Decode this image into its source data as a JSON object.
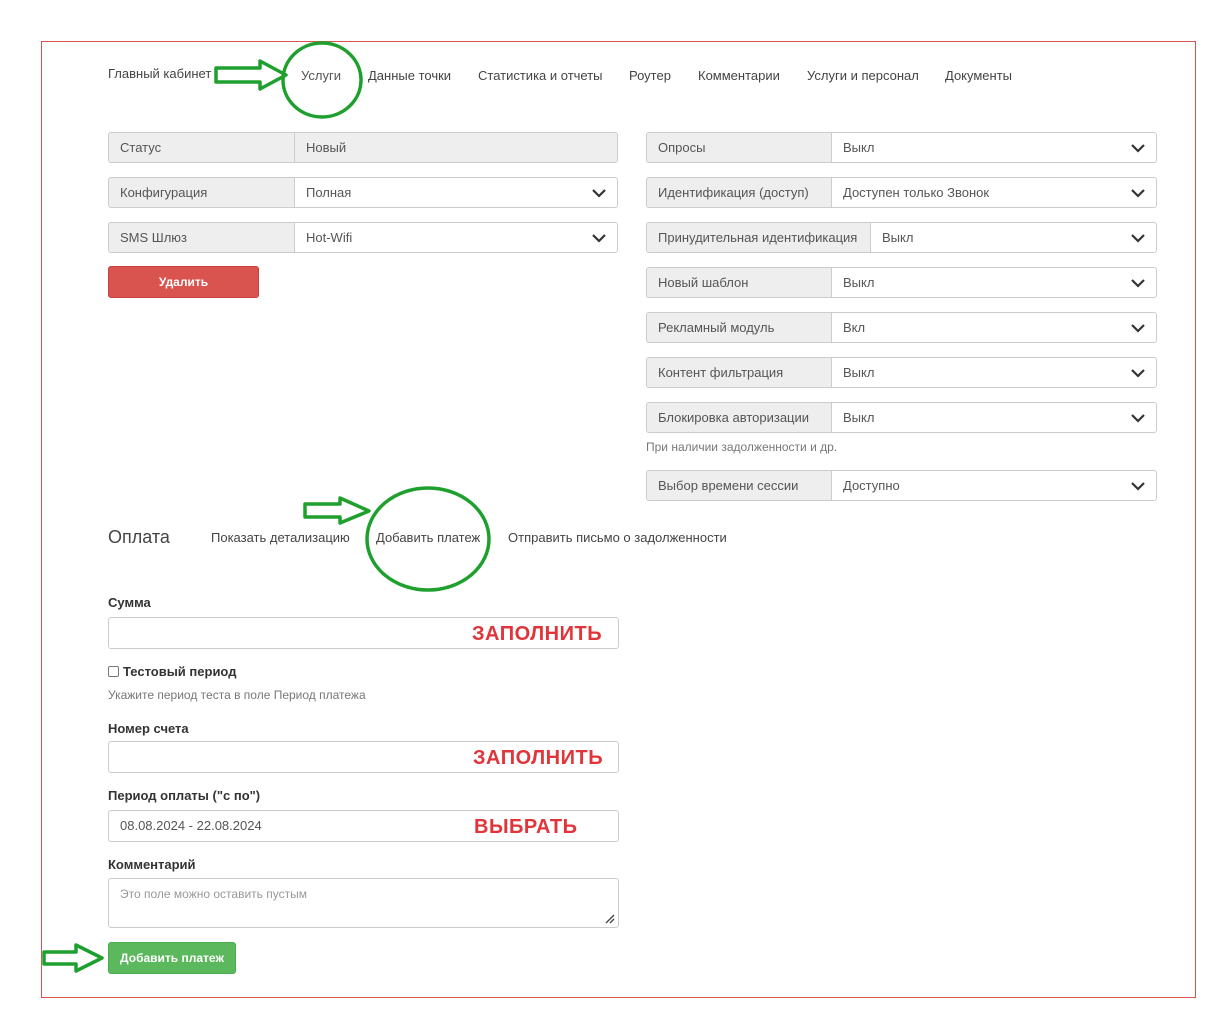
{
  "nav": {
    "items": [
      "Главный кабинет",
      "Услуги",
      "Данные точки",
      "Статистика и отчеты",
      "Роутер",
      "Комментарии",
      "Услуги и персонал",
      "Документы"
    ]
  },
  "left_fields": [
    {
      "label": "Статус",
      "value": "Новый"
    },
    {
      "label": "Конфигурация",
      "value": "Полная"
    },
    {
      "label": "SMS Шлюз",
      "value": "Hot-Wifi"
    }
  ],
  "delete_button": "Удалить",
  "right_fields": [
    {
      "label": "Опросы",
      "value": "Выкл"
    },
    {
      "label": "Идентификация (доступ)",
      "value": "Доступен только Звонок"
    },
    {
      "label": "Принудительная идентификация",
      "value": "Выкл"
    },
    {
      "label": "Новый шаблон",
      "value": "Выкл"
    },
    {
      "label": "Рекламный модуль",
      "value": "Вкл"
    },
    {
      "label": "Контент фильтрация",
      "value": "Выкл"
    },
    {
      "label": "Блокировка авторизации",
      "value": "Выкл"
    },
    {
      "label": "Выбор времени сессии",
      "value": "Доступно"
    }
  ],
  "block_help": "При наличии задолженности и др.",
  "payment": {
    "title": "Оплата",
    "tabs": [
      "Показать детализацию",
      "Добавить платеж",
      "Отправить письмо о задолженности"
    ],
    "sum_label": "Сумма",
    "sum_value": "",
    "test_period_label": "Тестовый период",
    "test_period_help": "Укажите период теста в поле Период платежа",
    "account_label": "Номер счета",
    "account_value": "",
    "period_label": "Период оплаты (\"с по\")",
    "period_value": "08.08.2024 - 22.08.2024",
    "comment_label": "Комментарий",
    "comment_placeholder": "Это поле можно оставить пустым",
    "submit": "Добавить платеж"
  },
  "annotations": {
    "fill_1": "ЗАПОЛНИТЬ",
    "fill_2": "ЗАПОЛНИТЬ",
    "choose": "ВЫБРАТЬ"
  },
  "colors": {
    "danger": "#d9534f",
    "success": "#5cb85c",
    "annotation_green": "#1fa02e",
    "annotation_red": "#e0353b"
  }
}
